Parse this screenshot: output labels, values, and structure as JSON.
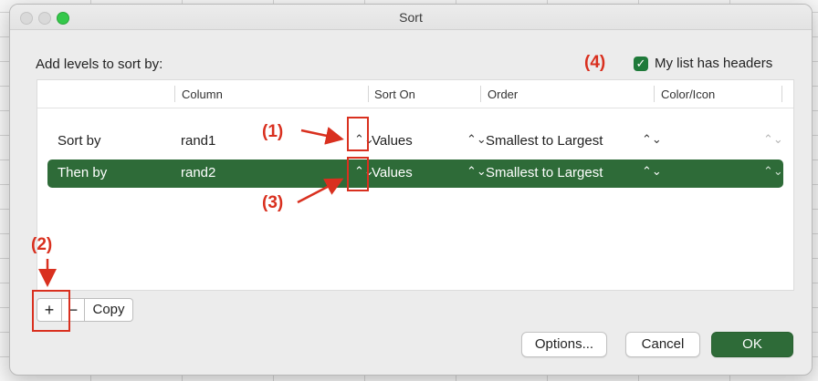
{
  "window": {
    "title": "Sort"
  },
  "dialog": {
    "add_levels_label": "Add levels to sort by:",
    "headers_checkbox": {
      "label": "My list has headers",
      "checked": true,
      "check_glyph": "✓"
    }
  },
  "columns": [
    "Column",
    "Sort On",
    "Order",
    "Color/Icon"
  ],
  "rows": [
    {
      "label": "Sort by",
      "column": "rand1",
      "sort_on": "Values",
      "order": "Smallest to Largest",
      "selected": false
    },
    {
      "label": "Then by",
      "column": "rand2",
      "sort_on": "Values",
      "order": "Smallest to Largest",
      "selected": true
    }
  ],
  "stepper_glyph": "⌃⌄",
  "level_buttons": {
    "add": "+",
    "remove": "−",
    "copy": "Copy"
  },
  "footer": {
    "options": "Options...",
    "cancel": "Cancel",
    "ok": "OK"
  },
  "annotations": {
    "a1": "(1)",
    "a2": "(2)",
    "a3": "(3)",
    "a4": "(4)"
  },
  "colors": {
    "accent": "#2e6b38",
    "annotation": "#d9301f"
  }
}
